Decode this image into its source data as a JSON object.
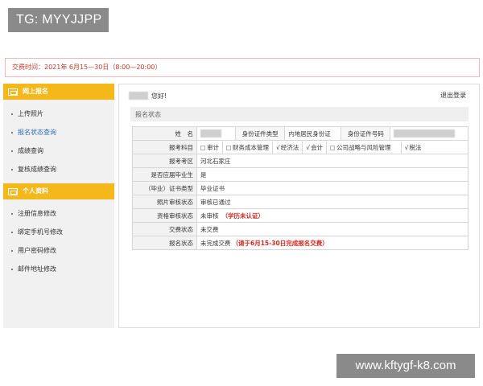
{
  "overlay": {
    "tg_label": "TG: MYYJJPP",
    "watermark": "www.kftygf-k8.com"
  },
  "banner": {
    "exam_time": "交费时间：2021年 6月15—30日（8:00—20:00）"
  },
  "sidebar": {
    "online_header": "网上报名",
    "online_items": [
      "上传照片",
      "报名状态查询",
      "成绩查询",
      "复核成绩查询"
    ],
    "active_item": "报名状态查询",
    "personal_header": "个人资料",
    "personal_items": [
      "注册信息修改",
      "绑定手机号修改",
      "用户密码修改",
      "邮件地址修改"
    ]
  },
  "main": {
    "greeting": "您好!",
    "logout": "退出登录",
    "section_title": "报名状态",
    "labels": {
      "name": "姓　名",
      "id_type": "身份证件类型",
      "id_type_value": "内地居民身份证",
      "id_number": "身份证件号码",
      "subjects": "报考科目",
      "region": "报考考区",
      "fresh_grad": "是否应届毕业生",
      "cert_type": "（毕业）证书类型",
      "photo_status": "照片审核状态",
      "qual_status": "资格审核状态",
      "pay_status": "交费状态",
      "reg_status": "报名状态"
    },
    "subjects": [
      {
        "name": "审计",
        "checked": false
      },
      {
        "name": "财务成本管理",
        "checked": false
      },
      {
        "name": "经济法",
        "checked": true
      },
      {
        "name": "会计",
        "checked": true
      },
      {
        "name": "公司战略与风险管理",
        "checked": false
      },
      {
        "name": "税法",
        "checked": true
      }
    ],
    "checked_mark": "√",
    "values": {
      "region": "河北石家庄",
      "fresh_grad": "是",
      "cert_type": "毕业证书",
      "photo_status": "审核已通过",
      "qual_status": "未审核",
      "qual_note": "（学历未认证）",
      "pay_status": "未交费",
      "reg_status": "未完成交费",
      "reg_note": "（请于6月15-30日完成报名交费）"
    }
  },
  "colors": {
    "accent": "#f5b81b",
    "alert_red": "#d0281e",
    "link_blue": "#2e6db4"
  }
}
